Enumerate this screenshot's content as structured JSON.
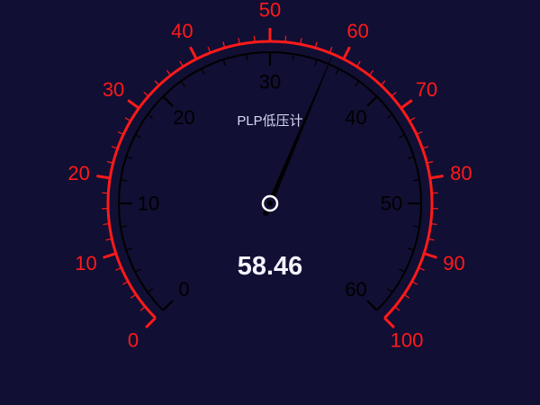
{
  "colors": {
    "background": "#110f33",
    "outer_scale": "#ff1a1a",
    "inner_scale": "#000000",
    "needle": "#000000",
    "title": "#d8d6f2",
    "value": "#f2f2ff",
    "hub_stroke": "#ffffff"
  },
  "chart_data": {
    "type": "gauge",
    "title": "PLP低压计",
    "value_label": "58.46",
    "outer_scale": {
      "min": 0,
      "max": 100,
      "major_ticks": [
        0,
        10,
        20,
        30,
        40,
        50,
        60,
        70,
        80,
        90,
        100
      ],
      "tick_labels": [
        "0",
        "10",
        "20",
        "30",
        "40",
        "50",
        "60",
        "70",
        "80",
        "90",
        "100"
      ]
    },
    "inner_scale": {
      "min": 0,
      "max": 60,
      "major_ticks": [
        0,
        10,
        20,
        30,
        40,
        50,
        60
      ],
      "tick_labels": [
        "0",
        "10",
        "20",
        "30",
        "40",
        "50",
        "60"
      ]
    },
    "needle_value_outer": 58.46
  }
}
